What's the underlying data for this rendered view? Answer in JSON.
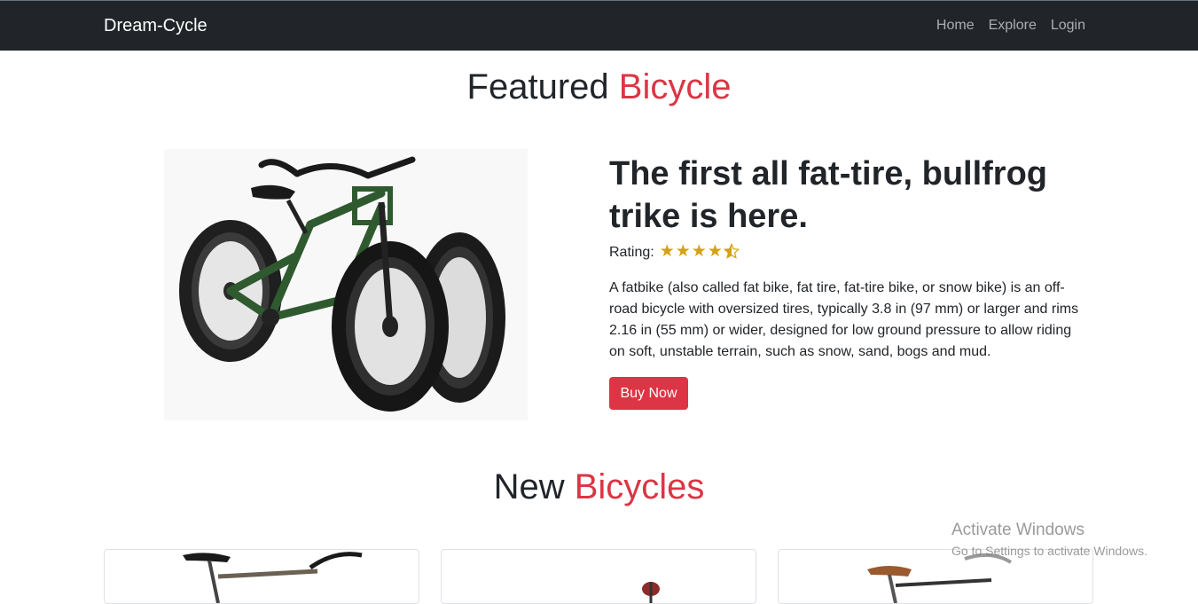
{
  "navbar": {
    "brand": "Dream-Cycle",
    "links": [
      "Home",
      "Explore",
      "Login"
    ]
  },
  "featured": {
    "title_prefix": "Featured",
    "title_accent": "Bicycle",
    "headline": "The first all fat-tire, bullfrog trike is here.",
    "rating_label": "Rating:",
    "rating_value": 4.5,
    "description": "A fatbike (also called fat bike, fat tire, fat-tire bike, or snow bike) is an off-road bicycle with oversized tires, typically 3.8 in (97 mm) or larger and rims 2.16 in (55 mm) or wider, designed for low ground pressure to allow riding on soft, unstable terrain, such as snow, sand, bogs and mud.",
    "buy_label": "Buy Now"
  },
  "new_section": {
    "title_prefix": "New",
    "title_accent": "Bicycles"
  },
  "watermark": {
    "title": "Activate Windows",
    "subtitle": "Go to Settings to activate Windows."
  },
  "colors": {
    "accent": "#dc3545",
    "navbar_bg": "#212529",
    "star": "#d4a017"
  }
}
